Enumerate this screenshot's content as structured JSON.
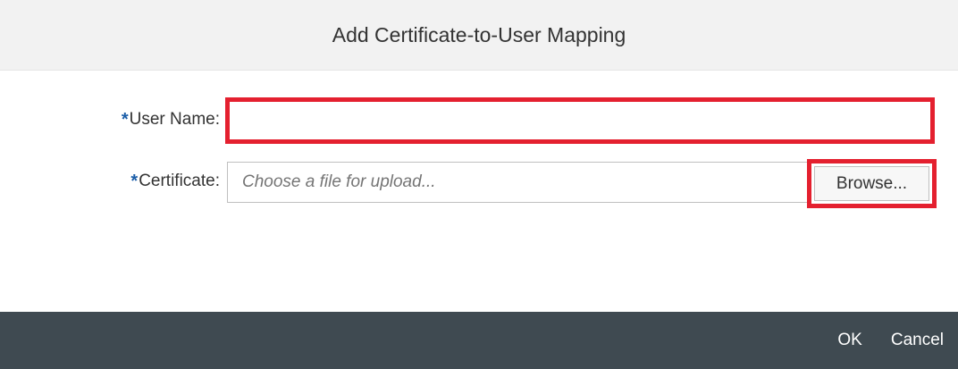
{
  "dialog": {
    "title": "Add Certificate-to-User Mapping"
  },
  "form": {
    "username": {
      "required_marker": "*",
      "label": "User Name:",
      "value": ""
    },
    "certificate": {
      "required_marker": "*",
      "label": "Certificate:",
      "placeholder": "Choose a file for upload...",
      "browse_label": "Browse..."
    }
  },
  "footer": {
    "ok_label": "OK",
    "cancel_label": "Cancel"
  },
  "colors": {
    "highlight": "#e4202f",
    "required_star": "#1a5da8",
    "footer_bg": "#3f4a51",
    "header_bg": "#f2f2f2"
  }
}
